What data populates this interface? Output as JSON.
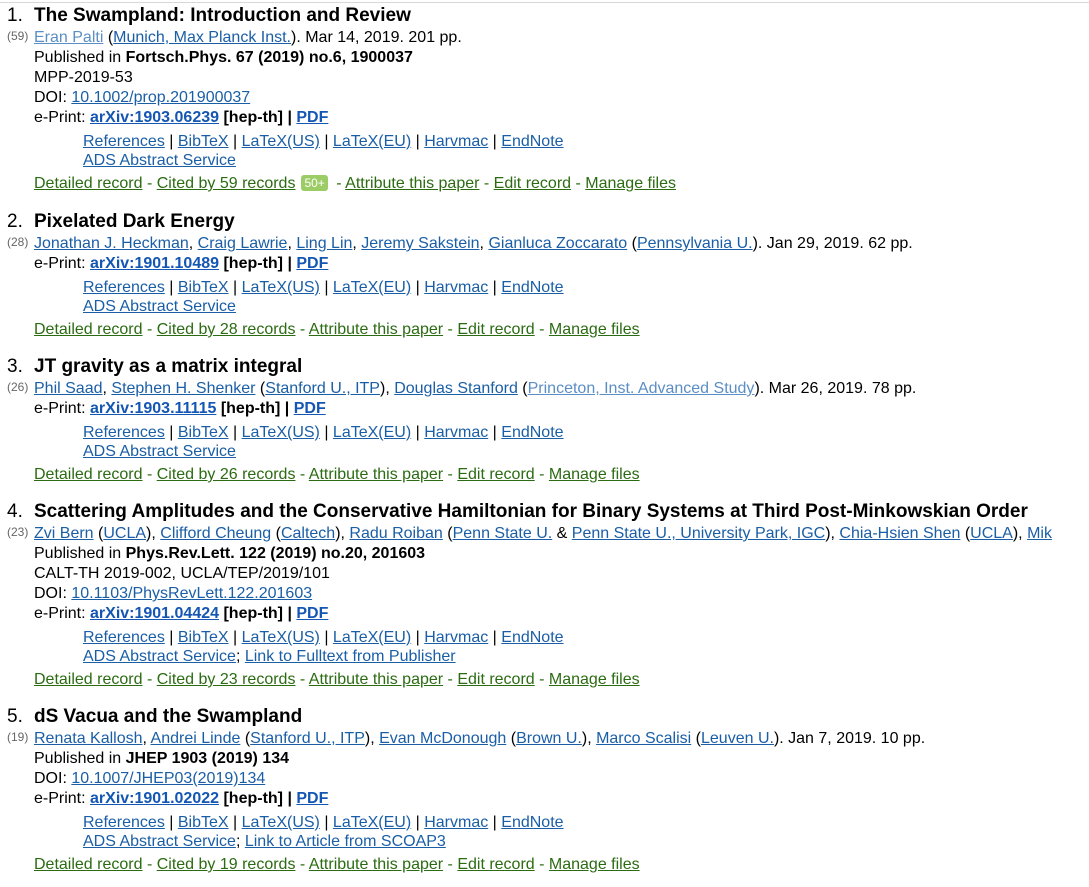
{
  "records": [
    {
      "num": "1.",
      "title": "The Swampland: Introduction and Review",
      "cites": "(59)",
      "authors_line": {
        "a1": "Eran Palti",
        "aff1": "Munich, Max Planck Inst.",
        "rest": ". Mar 14, 2019. 201 pp."
      },
      "published_label": "Published in ",
      "journal": "Fortsch.Phys. 67 (2019) no.6, 1900037",
      "report": "MPP-2019-53",
      "doi_label": "DOI: ",
      "doi": "10.1002/prop.201900037",
      "eprint_label": "e-Print: ",
      "arxiv": "arXiv:1903.06239",
      "category": " [hep-th]",
      "pdf": "PDF",
      "ads": "ADS Abstract Service",
      "cited_by": "Cited by 59 records",
      "badge": "50+"
    },
    {
      "num": "2.",
      "title": "Pixelated Dark Energy",
      "cites": "(28)",
      "authors_line": {
        "a1": "Jonathan J. Heckman",
        "a2": "Craig Lawrie",
        "a3": "Ling Lin",
        "a4": "Jeremy Sakstein",
        "a5": "Gianluca Zoccarato",
        "aff1": "Pennsylvania U.",
        "rest": ". Jan 29, 2019. 62 pp."
      },
      "eprint_label": "e-Print: ",
      "arxiv": "arXiv:1901.10489",
      "category": " [hep-th]",
      "pdf": "PDF",
      "ads": "ADS Abstract Service",
      "cited_by": "Cited by 28 records"
    },
    {
      "num": "3.",
      "title": "JT gravity as a matrix integral",
      "cites": "(26)",
      "authors_line": {
        "a1": "Phil Saad",
        "a2": "Stephen H. Shenker",
        "aff1": "Stanford U., ITP",
        "a3": "Douglas Stanford",
        "aff2": "Princeton, Inst. Advanced Study",
        "rest": ". Mar 26, 2019. 78 pp."
      },
      "eprint_label": "e-Print: ",
      "arxiv": "arXiv:1903.11115",
      "category": " [hep-th]",
      "pdf": "PDF",
      "ads": "ADS Abstract Service",
      "cited_by": "Cited by 26 records"
    },
    {
      "num": "4.",
      "title": "Scattering Amplitudes and the Conservative Hamiltonian for Binary Systems at Third Post-Minkowskian Order",
      "cites": "(23)",
      "authors_line": {
        "a1": "Zvi Bern",
        "aff1": "UCLA",
        "a2": "Clifford Cheung",
        "aff2": "Caltech",
        "a3": "Radu Roiban",
        "aff3": "Penn State U.",
        "amp": " & ",
        "aff4": "Penn State U., University Park, IGC",
        "a4": "Chia-Hsien Shen",
        "aff5": "UCLA",
        "a5": "Mik"
      },
      "published_label": "Published in ",
      "journal": "Phys.Rev.Lett. 122 (2019) no.20, 201603",
      "report": "CALT-TH 2019-002, UCLA/TEP/2019/101",
      "doi_label": "DOI: ",
      "doi": "10.1103/PhysRevLett.122.201603",
      "eprint_label": "e-Print: ",
      "arxiv": "arXiv:1901.04424",
      "category": " [hep-th]",
      "pdf": "PDF",
      "ads": "ADS Abstract Service",
      "extra_link": "Link to Fulltext from Publisher",
      "cited_by": "Cited by 23 records"
    },
    {
      "num": "5.",
      "title": "dS Vacua and the Swampland",
      "cites": "(19)",
      "authors_line": {
        "a1": "Renata Kallosh",
        "a2": "Andrei Linde",
        "aff1": "Stanford U., ITP",
        "a3": "Evan McDonough",
        "aff2": "Brown U.",
        "a4": "Marco Scalisi",
        "aff3": "Leuven U.",
        "rest": ". Jan 7, 2019. 10 pp."
      },
      "published_label": "Published in ",
      "journal": "JHEP 1903 (2019) 134",
      "doi_label": "DOI: ",
      "doi": "10.1007/JHEP03(2019)134",
      "eprint_label": "e-Print: ",
      "arxiv": "arXiv:1901.02022",
      "category": " [hep-th]",
      "pdf": "PDF",
      "ads": "ADS Abstract Service",
      "extra_link": "Link to Article from SCOAP3",
      "cited_by": "Cited by 19 records"
    }
  ],
  "formats": {
    "references": "References",
    "bibtex": "BibTeX",
    "latex_us": "LaTeX(US)",
    "latex_eu": "LaTeX(EU)",
    "harvmac": "Harvmac",
    "endnote": "EndNote"
  },
  "actions": {
    "detailed": "Detailed record",
    "attribute": "Attribute this paper",
    "edit": "Edit record",
    "manage": "Manage files"
  },
  "sep": {
    "pipe": " | ",
    "dash": " - ",
    "comma": ", ",
    "open": " (",
    "close": ")",
    "close_comma": "), ",
    "semi": "; ",
    "pdf_sep": " | "
  }
}
